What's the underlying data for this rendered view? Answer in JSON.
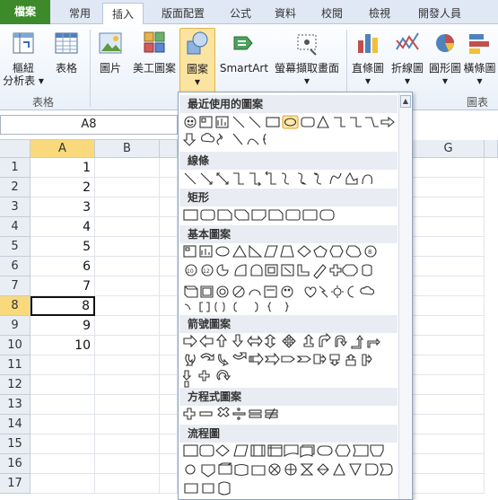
{
  "tabs": [
    "檔案",
    "常用",
    "插入",
    "版面配置",
    "公式",
    "資料",
    "校閱",
    "檢視",
    "開發人員"
  ],
  "ribbon": {
    "pivot_label_1": "樞紐",
    "pivot_label_2": "分析表 ▾",
    "table_label": "表格",
    "picture_label": "圖片",
    "clipart_label": "美工圖案",
    "shapes_label_1": "圖案",
    "shapes_label_2": "▾",
    "smartart_label": "SmartArt",
    "screenshot_label_1": "螢幕擷取畫面",
    "screenshot_label_2": "▾",
    "column_label_1": "直條圖",
    "column_label_2": "▾",
    "line_label_1": "折線圖",
    "line_label_2": "▾",
    "pie_label_1": "圓形圖",
    "pie_label_2": "▾",
    "bar_label_1": "橫條圖",
    "bar_label_2": "▾",
    "group_tables": "表格",
    "group_charts": "圖表"
  },
  "name_box": "A8",
  "columns": [
    "A",
    "B",
    "G"
  ],
  "rows": [
    "1",
    "2",
    "3",
    "4",
    "5",
    "6",
    "7",
    "8",
    "9",
    "10",
    "11",
    "12",
    "13",
    "14",
    "15",
    "16",
    "17"
  ],
  "cellA": [
    "1",
    "2",
    "3",
    "4",
    "5",
    "6",
    "7",
    "8",
    "9",
    "10"
  ],
  "menu": {
    "sections": [
      "最近使用的圖案",
      "線條",
      "矩形",
      "基本圖案",
      "箭號圖案",
      "方程式圖案",
      "流程圖"
    ]
  }
}
